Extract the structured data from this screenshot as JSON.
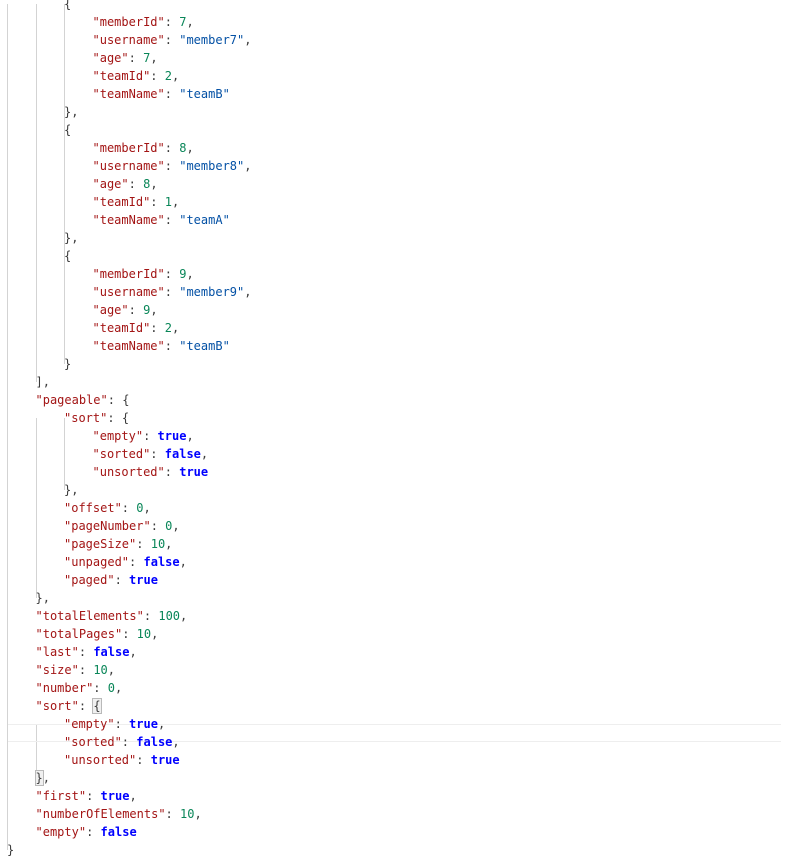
{
  "editor": {
    "content_lines": [
      "{",
      "\"memberId\": 7,",
      "\"username\": \"member7\",",
      "\"age\": 7,",
      "\"teamId\": 2,",
      "\"teamName\": \"teamB\"",
      "},",
      "{",
      "\"memberId\": 8,",
      "\"username\": \"member8\",",
      "\"age\": 8,",
      "\"teamId\": 1,",
      "\"teamName\": \"teamA\"",
      "},",
      "{",
      "\"memberId\": 9,",
      "\"username\": \"member9\",",
      "\"age\": 9,",
      "\"teamId\": 2,",
      "\"teamName\": \"teamB\"",
      "}",
      "],",
      "\"pageable\": {",
      "\"sort\": {",
      "\"empty\": true,",
      "\"sorted\": false,",
      "\"unsorted\": true",
      "},",
      "\"offset\": 0,",
      "\"pageNumber\": 0,",
      "\"pageSize\": 10,",
      "\"unpaged\": false,",
      "\"paged\": true",
      "},",
      "\"totalElements\": 100,",
      "\"totalPages\": 10,",
      "\"last\": false,",
      "\"size\": 10,",
      "\"number\": 0,",
      "\"sort\": {",
      "\"empty\": true,",
      "\"sorted\": false,",
      "\"unsorted\": true",
      "},",
      "\"first\": true,",
      "\"numberOfElements\": 10,",
      "\"empty\": false",
      "}"
    ],
    "colors": {
      "background": "#ffffff",
      "key": "#a31515",
      "string": "#0451a5",
      "number": "#098658",
      "boolean": "#0000ff",
      "punctuation": "#3b3b3b",
      "indent_guide": "#d3d3d3"
    }
  }
}
